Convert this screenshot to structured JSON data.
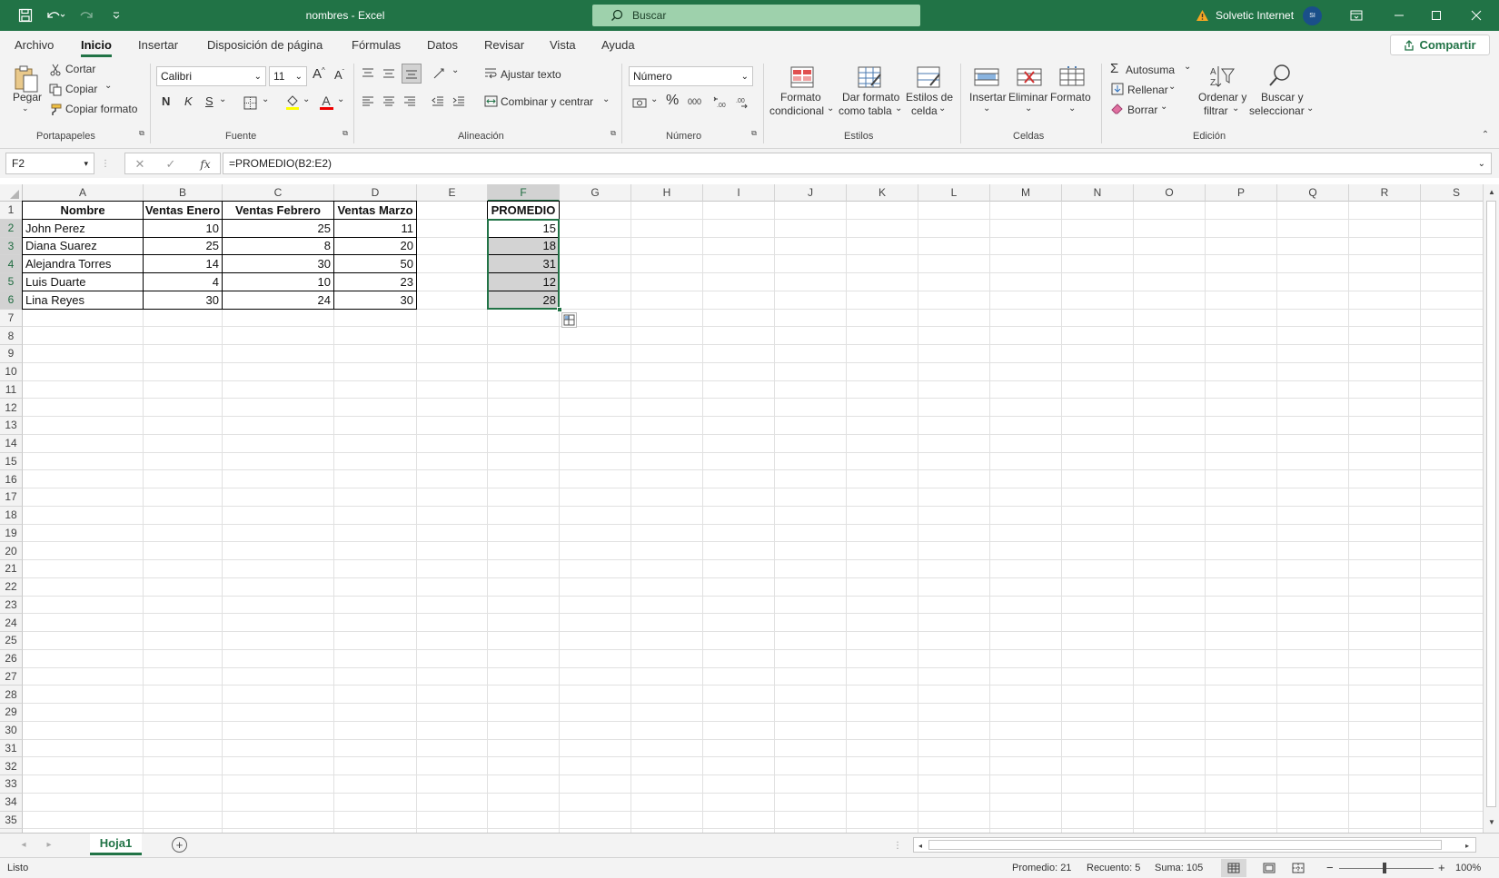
{
  "window": {
    "doc_name": "nombres",
    "separator": "-",
    "app_name": "Excel",
    "search_placeholder": "Buscar",
    "user": "Solvetic Internet",
    "user_initials": "SI"
  },
  "menu": [
    "Archivo",
    "Inicio",
    "Insertar",
    "Disposición de página",
    "Fórmulas",
    "Datos",
    "Revisar",
    "Vista",
    "Ayuda"
  ],
  "share_label": "Compartir",
  "ribbon": {
    "clipboard": {
      "paste": "Pegar",
      "cut": "Cortar",
      "copy": "Copiar",
      "format_painter": "Copiar formato",
      "group": "Portapapeles"
    },
    "font": {
      "family": "Calibri",
      "size": "11",
      "bold": "N",
      "italic": "K",
      "underline": "S",
      "grow": "A",
      "shrink": "A",
      "color_a": "A",
      "group": "Fuente"
    },
    "alignment": {
      "wrap": "Ajustar texto",
      "merge": "Combinar y centrar",
      "group": "Alineación"
    },
    "number": {
      "format": "Número",
      "percent": "%",
      "thousands": "000",
      "group": "Número"
    },
    "styles": {
      "cond1": "Formato",
      "cond2": "condicional",
      "table1": "Dar formato",
      "table2": "como tabla",
      "cell1": "Estilos de",
      "cell2": "celda",
      "group": "Estilos"
    },
    "cells": {
      "insert": "Insertar",
      "delete": "Eliminar",
      "format": "Formato",
      "group": "Celdas"
    },
    "editing": {
      "autosum": "Autosuma",
      "fill": "Rellenar",
      "clear": "Borrar",
      "sort1": "Ordenar y",
      "sort2": "filtrar",
      "find1": "Buscar y",
      "find2": "seleccionar",
      "group": "Edición"
    }
  },
  "formula_bar": {
    "name_box": "F2",
    "fx": "fx",
    "formula": "=PROMEDIO(B2:E2)"
  },
  "grid": {
    "columns": [
      "A",
      "B",
      "C",
      "D",
      "E",
      "F",
      "G",
      "H",
      "I",
      "J",
      "K",
      "L",
      "M",
      "N",
      "O",
      "P",
      "Q",
      "R",
      "S"
    ],
    "selected_column": "F",
    "headers": {
      "A": "Nombre",
      "B": "Ventas Enero",
      "C": "Ventas Febrero",
      "D": "Ventas Marzo",
      "F": "PROMEDIO"
    },
    "rows": [
      {
        "name": "John Perez",
        "b": "10",
        "c": "25",
        "d": "11",
        "f": "15"
      },
      {
        "name": "Diana Suarez",
        "b": "25",
        "c": "8",
        "d": "20",
        "f": "18"
      },
      {
        "name": "Alejandra Torres",
        "b": "14",
        "c": "30",
        "d": "50",
        "f": "31"
      },
      {
        "name": "Luis Duarte",
        "b": "4",
        "c": "10",
        "d": "23",
        "f": "12"
      },
      {
        "name": "Lina Reyes",
        "b": "30",
        "c": "24",
        "d": "30",
        "f": "28"
      }
    ]
  },
  "sheet_tab": "Hoja1",
  "status": {
    "ready": "Listo",
    "average": "Promedio: 21",
    "count": "Recuento: 5",
    "sum": "Suma: 105",
    "zoom": "100%"
  },
  "colors": {
    "accent": "#217346",
    "selection": "#d3d3d3"
  }
}
